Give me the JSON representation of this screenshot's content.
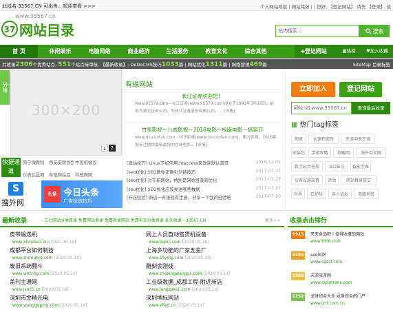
{
  "topbar": {
    "left": "此域名 33567.CN 可出售，欢迎查看 >>>",
    "right_links": "个人网站导航 | 网站特效 | | 您好, 【登记网站】 请先 【登录】 或"
  },
  "logo": {
    "url_text": "www.33567.cn",
    "circle_text": "37",
    "name": "网站目录"
  },
  "search": {
    "placeholder": "站内搜索...",
    "button": "搜索"
  },
  "nav": {
    "items": [
      "首 页",
      "休闲娱乐",
      "电脑网络",
      "商业经济",
      "生活服务",
      "教育文化",
      "综合其他"
    ],
    "register": "登记网站",
    "hot": "热榜",
    "favorite": "加入收藏"
  },
  "stats": {
    "prefix": "共收录",
    "sites": "2306",
    "sites_label": "个优秀站点,",
    "pending": "551",
    "pending_label": "个站点待审核,",
    "tail": "【最新收录】: DeDeCMS技巧",
    "cms": "1033",
    "cms_label": "篇 | 网站优化",
    "seo": "1311",
    "seo_label": "篇 | 网络营销",
    "market": "469",
    "market_label": "篇",
    "right": "SiteMap  目录标签  "
  },
  "share": "分享",
  "banner": {
    "placeholder": "300×200",
    "slide1": "1",
    "slide2": "2"
  },
  "quick": {
    "title": "快捷通道",
    "links": [
      "南宁微教科",
      "西安安保协会",
      "中国机械设",
      "仪表武昱网",
      "阜阳网站目",
      "鸡笼网网"
    ]
  },
  "ads": {
    "sohu_icon": "S",
    "sohu": "搜外网",
    "tt_logo": "头条",
    "tt_title": "今日头条",
    "tt_sub": "广告投放技巧"
  },
  "middle": {
    "title": "有缘网站",
    "article1_title": "长江证券欢迎您！",
    "article1_body": "www.95579.com—长江证券(www.95579.com)成立于1991年3月18日，前身为湖北证券公司，为长江证券股份有限公司。... [详情]",
    "article2_title": "竹笙影视—八戒影视—2018电影—枪版电影—搞笑节",
    "article2_body": "www.niucuntao.com - 村汗影视(www.niucuntao.com)，第九影视，2016影视专注提供最新最快的在线电影... [详情]",
    "list": [
      {
        "t": "[建站技巧] Linux下如何用.htaccess来改变默认首页",
        "d": "2018-12-05"
      },
      {
        "t": "[seo优化] SEO教你正确引外链技巧",
        "d": "2017-07-27"
      },
      {
        "t": "[seo优化] 对于新网站，特别是网站目录的优化",
        "d": "2017-07-27"
      },
      {
        "t": "[seo优化] SEO优化应该关注哪些数据",
        "d": "2017-07-27"
      },
      {
        "t": "[开店经验] 新店一开张就有生意，分享一下我的经验吧",
        "d": "2017-07-20"
      }
    ]
  },
  "right": {
    "join": "立即加入",
    "login": "登记网站",
    "rank_placeholder": "网址 如 www.33567.cn",
    "rank_button": "查询最后收录",
    "tag_title": "热门tag标签",
    "tags": [
      "陶瓷",
      "大理石瓷砖",
      "天津中央空调",
      "安装包",
      "手游攻略",
      "地暖网",
      "海外中文网",
      "数字公共电视",
      "汉口车头",
      "智能手表",
      "仪表仪器装置",
      "活动",
      "网站目录提交",
      "世界",
      "石护栏",
      "亲人论坛",
      "电脑系统"
    ]
  },
  "latest": {
    "title": "最新收录",
    "subtitle": "- 三七网站分类目录 免费网站目录 免费收录网站 免费中文分类目录 永久收录 - 33567.CN",
    "more": "更多>>",
    "sites": [
      {
        "n": "皮带输送机",
        "u": "www.xiondass.cn",
        "d": "[2020.06.18]"
      },
      {
        "n": "网上人员自动售货机设备",
        "u": "www.bqxcj.com",
        "d": "[2020.05.26]"
      },
      {
        "n": "成都平台如何制技",
        "u": "www.zhongkrg.com",
        "d": "[2020.05.20]"
      },
      {
        "n": "上海多功能的厂家五金厂",
        "u": "www.shydqj.com",
        "d": "[2020.05.20]"
      },
      {
        "n": "废旧系统翻斗",
        "u": "www.whtnhp.com",
        "d": "[2020.05.14]"
      },
      {
        "n": "雕刻金刚线",
        "u": "www.zhexingwangye.com",
        "d": "[2020.05.14]"
      },
      {
        "n": "盖刊主通网",
        "u": "www.jsnil5.cn",
        "d": "[2020.05.14]"
      },
      {
        "n": "工业级数据_成都工程-附近新店",
        "u": "www.langzakeji.com",
        "d": "[2020.05.14]"
      },
      {
        "n": "深圳市金精光电",
        "u": "www.wanggeping.com",
        "d": "[2020.05.14]"
      },
      {
        "n": "深圳地标网站",
        "u": "www.vfled.cn",
        "d": "[2020.05.14]"
      }
    ]
  },
  "hot": {
    "title": "收录点击排行",
    "items": [
      {
        "b": "9915",
        "c": "#f07d0d",
        "n": "天天食品吧丨值得收藏的网站",
        "u": "www.tttt8.club"
      },
      {
        "b": "6284",
        "c": "#f0a020",
        "n": "seo知识",
        "u": "www.seozf.com"
      },
      {
        "b": "1588",
        "c": "#f0c040",
        "n": "天津旅游网",
        "u": "www.ciplotrans.com"
      },
      {
        "b": "1252",
        "c": "#7cc250",
        "n": "龙财综合大全 龙财综合的门户",
        "u": "www.lyrt.com.cn"
      }
    ]
  }
}
